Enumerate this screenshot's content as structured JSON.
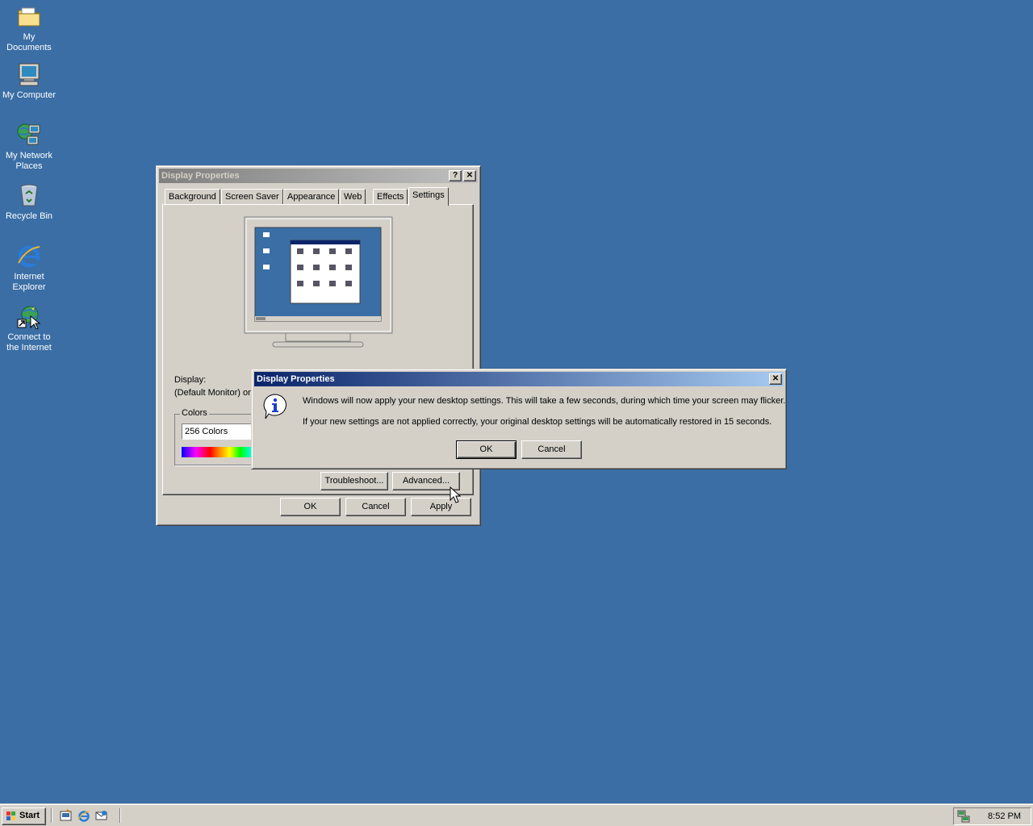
{
  "desktop": {
    "icons": [
      {
        "label_lines": [
          "My Documents"
        ],
        "icon": "folder-icon"
      },
      {
        "label_lines": [
          "My Computer"
        ],
        "icon": "computer-icon"
      },
      {
        "label_lines": [
          "My Network",
          "Places"
        ],
        "icon": "network-icon"
      },
      {
        "label_lines": [
          "Recycle Bin"
        ],
        "icon": "recycle-bin-icon"
      },
      {
        "label_lines": [
          "Internet",
          "Explorer"
        ],
        "icon": "internet-explorer-icon"
      },
      {
        "label_lines": [
          "Connect to",
          "the Internet"
        ],
        "icon": "connect-internet-icon"
      }
    ],
    "background": "#3a6ea5"
  },
  "display_properties": {
    "title": "Display Properties",
    "help_btn": "?",
    "close_btn": "✕",
    "tabs": [
      "Background",
      "Screen Saver",
      "Appearance",
      "Web",
      "Effects",
      "Settings"
    ],
    "selected_tab": "Settings",
    "display_label": "Display:",
    "display_value": "(Default Monitor) on",
    "colors_group": "Colors",
    "colors_value": "256 Colors",
    "troubleshoot_btn": "Troubleshoot...",
    "advanced_btn": "Advanced...",
    "ok_btn": "OK",
    "cancel_btn": "Cancel",
    "apply_btn": "Apply"
  },
  "confirm_dialog": {
    "title": "Display Properties",
    "close_btn": "✕",
    "message_1": "Windows will now apply your new desktop settings. This will take a few seconds, during which time your screen may flicker.",
    "message_2": "If your new settings are not applied correctly, your original desktop settings will be automatically restored in 15 seconds.",
    "ok_btn": "OK",
    "cancel_btn": "Cancel",
    "icon": "info-icon"
  },
  "taskbar": {
    "start_label": "Start",
    "quick_launch": [
      "show-desktop-icon",
      "ie-quicklaunch-icon",
      "outlook-express-icon"
    ],
    "clock": "8:52 PM",
    "tray_icon": "network-tray-icon"
  },
  "colors": {
    "titlebar_active_start": "#0a246a",
    "titlebar_active_end": "#a6caf0",
    "face": "#d4d0c8"
  }
}
